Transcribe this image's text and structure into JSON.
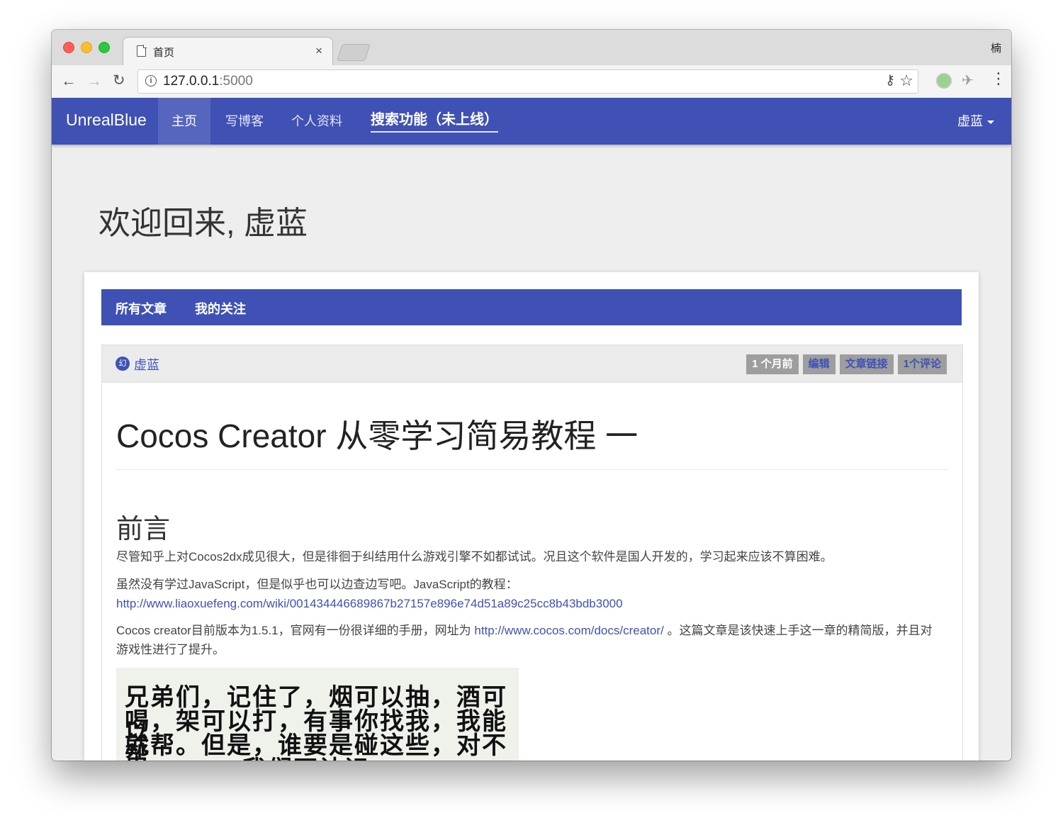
{
  "browser": {
    "tab_title": "首页",
    "tab_close": "×",
    "profile": "楠",
    "url_host": "127.0.0.1",
    "url_port": ":5000"
  },
  "site": {
    "brand": "UnrealBlue",
    "nav": {
      "home": "主页",
      "write": "写博客",
      "profile": "个人资料",
      "search": "搜索功能（未上线）"
    },
    "user": "虚蓝"
  },
  "welcome": "欢迎回来, 虚蓝",
  "tabs": {
    "all": "所有文章",
    "follow": "我的关注"
  },
  "post": {
    "author": "虚蓝",
    "badges": {
      "time": "1 个月前",
      "edit": "编辑",
      "link": "文章链接",
      "comments": "1个评论"
    },
    "title": "Cocos Creator 从零学习简易教程 一",
    "section": "前言",
    "para1": "尽管知乎上对Cocos2dx成见很大，但是徘徊于纠结用什么游戏引擎不如都试试。况且这个软件是国人开发的，学习起来应该不算困难。",
    "para2_text": "虽然没有学过JavaScript，但是似乎也可以边查边写吧。JavaScript的教程：",
    "para2_link": "http://www.liaoxuefeng.com/wiki/001434446689867b27157e896e74d51a89c25cc8b43bdb3000",
    "para3_a": "Cocos creator目前版本为1.5.1，官网有一份很详细的手册，网址为 ",
    "para3_link": "http://www.cocos.com/docs/creator/",
    "para3_b": " 。这篇文章是该快速上手这一章的精简版，并且对游戏性进行了提升。",
    "image_lines": [
      "兄弟们，记住了，烟可以抽，酒可以",
      "喝，架可以打，有事你找我，我能帮",
      "就帮。但是，谁要是碰这些，对不起",
      "我们不认识"
    ]
  }
}
